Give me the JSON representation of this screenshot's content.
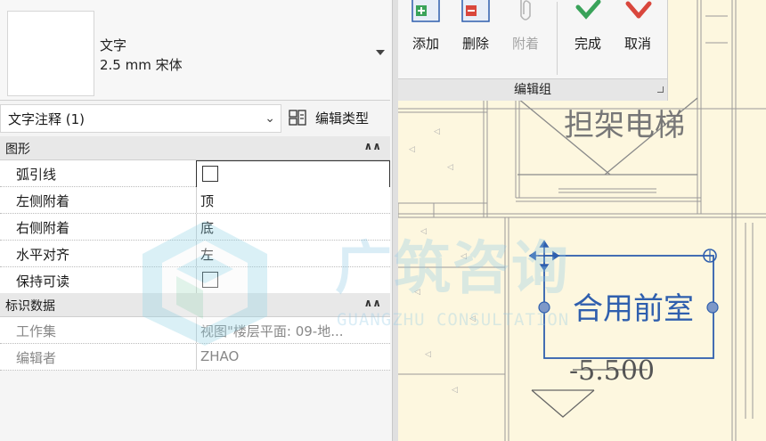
{
  "type_selector": {
    "family": "文字",
    "type": "2.5 mm 宋体"
  },
  "instance": {
    "label": "文字注释 (1)",
    "edit_type_label": "编辑类型"
  },
  "groups": {
    "graphics": {
      "title": "图形",
      "rows": [
        {
          "name": "弧引线",
          "kind": "checkbox",
          "checked": false
        },
        {
          "name": "左侧附着",
          "kind": "text",
          "value": "顶"
        },
        {
          "name": "右侧附着",
          "kind": "text",
          "value": "底"
        },
        {
          "name": "水平对齐",
          "kind": "text",
          "value": "左"
        },
        {
          "name": "保持可读",
          "kind": "checkbox",
          "checked": false
        }
      ]
    },
    "identity": {
      "title": "标识数据",
      "rows": [
        {
          "name": "工作集",
          "value": "视图\"楼层平面: 09-地..."
        },
        {
          "name": "编辑者",
          "value": "ZHAO"
        }
      ]
    }
  },
  "ribbon": {
    "buttons": [
      {
        "label": "添加"
      },
      {
        "label": "删除"
      },
      {
        "label": "附着"
      },
      {
        "label": "完成"
      },
      {
        "label": "取消"
      }
    ],
    "panel_title": "编辑组"
  },
  "canvas": {
    "elevator_label": "担架电梯",
    "text_note": "合用前室",
    "level": "-5.500"
  },
  "watermark": {
    "cn": "广筑咨询",
    "en": "GUANGZHU CONSULTATION"
  },
  "colors": {
    "accent": "#2f5fae",
    "drawing_line": "#8a8a8a",
    "canvas_bg": "#fdf7df",
    "done_green": "#3aa35a",
    "cancel_red": "#d9473d"
  }
}
